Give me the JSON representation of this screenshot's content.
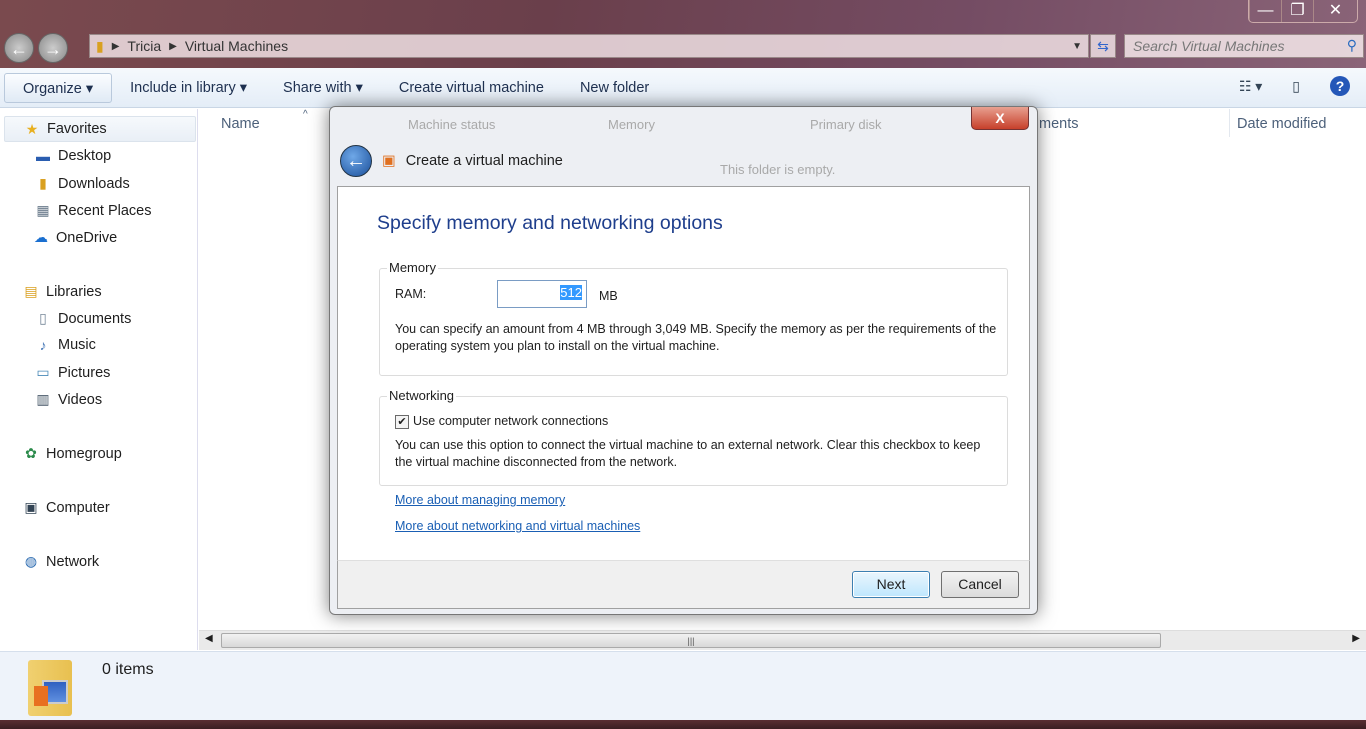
{
  "window": {
    "minimize": "—",
    "restore": "❐",
    "close": "✕"
  },
  "address": {
    "crumbs": [
      "Tricia",
      "Virtual Machines"
    ],
    "search_placeholder": "Search Virtual Machines"
  },
  "toolbar": {
    "organize": "Organize ▾",
    "include": "Include in library ▾",
    "share": "Share with ▾",
    "create": "Create virtual machine",
    "new_folder": "New folder"
  },
  "sidebar": {
    "favorites": "Favorites",
    "fav_items": [
      "Desktop",
      "Downloads",
      "Recent Places",
      "OneDrive"
    ],
    "libraries": "Libraries",
    "lib_items": [
      "Documents",
      "Music",
      "Pictures",
      "Videos"
    ],
    "homegroup": "Homegroup",
    "computer": "Computer",
    "network": "Network"
  },
  "columns": {
    "name": "Name",
    "status": "Machine status",
    "memory": "Memory",
    "disk": "Primary disk",
    "comments": "ments",
    "date": "Date modified",
    "empty": "This folder is empty."
  },
  "status": {
    "items": "0 items"
  },
  "dialog": {
    "title": "Create a virtual machine",
    "close": "X",
    "heading": "Specify memory and networking options",
    "memory": {
      "legend": "Memory",
      "ram_label": "RAM:",
      "ram_value": "512",
      "unit": "MB",
      "help": "You can specify an amount from 4 MB through 3,049 MB. Specify the memory as per the requirements of the operating system you plan to install on the virtual machine."
    },
    "networking": {
      "legend": "Networking",
      "checkbox_label": "Use computer network connections",
      "checked": true,
      "help": "You can use this option to connect the virtual machine to an external network. Clear this checkbox to keep the virtual machine disconnected from the network."
    },
    "links": [
      "More about managing memory",
      "More about networking and virtual machines"
    ],
    "next": "Next",
    "cancel": "Cancel"
  }
}
